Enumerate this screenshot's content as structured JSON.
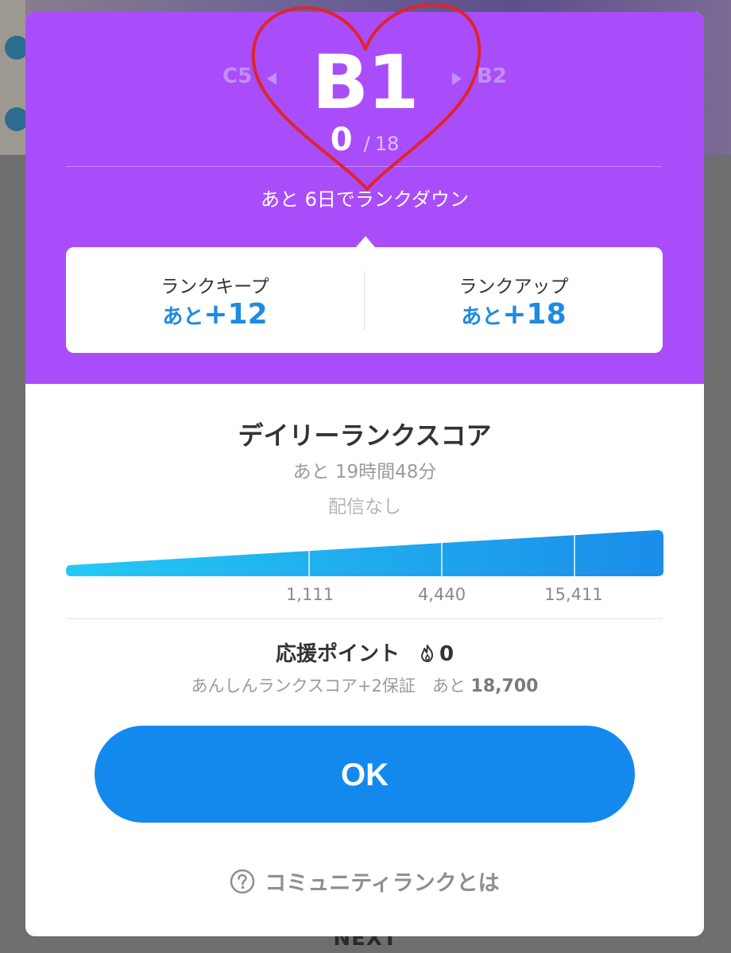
{
  "rank": {
    "current": "B1",
    "previous": "C5",
    "next": "B2",
    "points_current": "0",
    "points_separator": "/",
    "points_total": "18",
    "countdown_text": "あと 6日でランクダウン"
  },
  "rank_targets": {
    "keep": {
      "label": "ランクキープ",
      "prefix": "あと",
      "value": "+12"
    },
    "up": {
      "label": "ランクアップ",
      "prefix": "あと",
      "value": "+18"
    }
  },
  "daily_score": {
    "title": "デイリーランクスコア",
    "remaining": "あと 19時間48分",
    "stream_status": "配信なし",
    "progress": 0,
    "ticks": [
      "1,111",
      "4,440",
      "15,411"
    ]
  },
  "support": {
    "label": "応援ポイント",
    "icon": "fire-icon",
    "value": "0",
    "safe_text": "あんしんランクスコア+2保証　あと",
    "safe_remaining": "18,700"
  },
  "buttons": {
    "ok": "OK"
  },
  "help": {
    "label": "コミュニティランクとは",
    "icon": "question-circle-icon"
  },
  "background": {
    "next_label": "NEXT"
  },
  "colors": {
    "header": "#a94dfa",
    "accent_blue": "#1389ee",
    "value_blue": "#1f8be0",
    "heart_red": "#e0242c"
  }
}
